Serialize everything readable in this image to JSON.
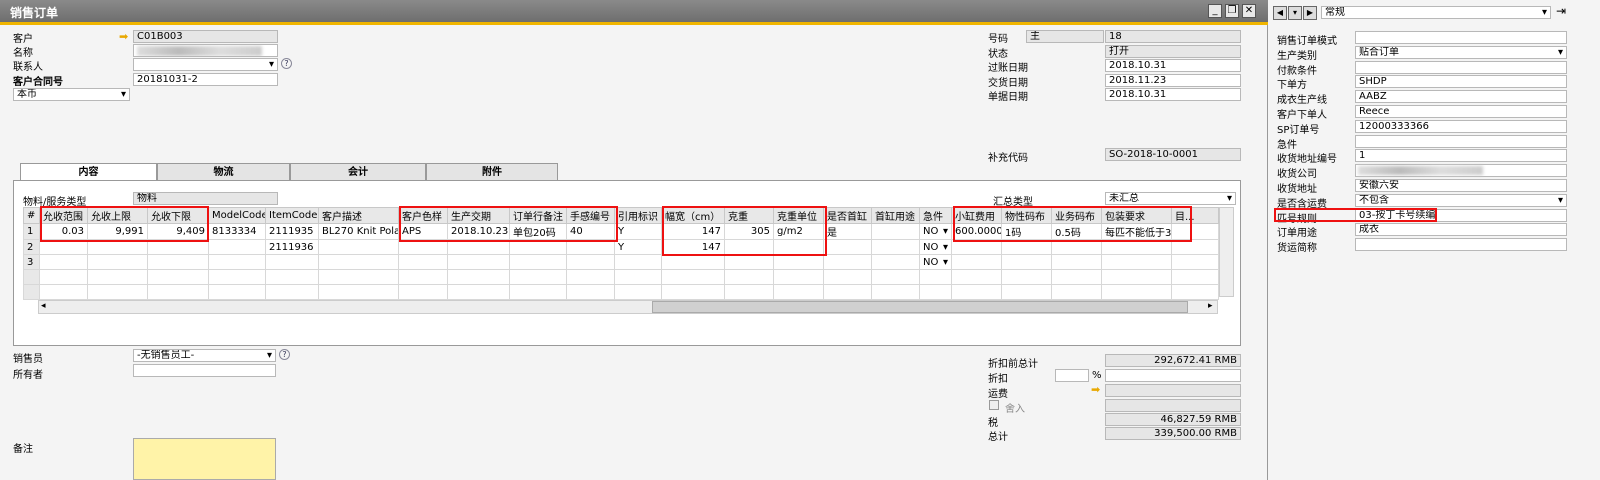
{
  "window": {
    "title": "销售订单"
  },
  "header_left": {
    "customer_label": "客户",
    "customer_value": "C01B003",
    "name_label": "名称",
    "contact_label": "联系人",
    "contract_label": "客户合同号",
    "contract_value": "20181031-2",
    "currency_value": "本币"
  },
  "header_right": {
    "number_label": "号码",
    "series_value": "主",
    "number_value": "18",
    "status_label": "状态",
    "status_value": "打开",
    "posting_label": "过账日期",
    "posting_value": "2018.10.31",
    "delivery_label": "交货日期",
    "delivery_value": "2018.11.23",
    "doc_date_label": "单据日期",
    "doc_date_value": "2018.10.31",
    "supp_code_label": "补充代码",
    "supp_code_value": "SO-2018-10-0001"
  },
  "tabs": [
    "内容",
    "物流",
    "会计",
    "附件"
  ],
  "content": {
    "item_type_label": "物料/服务类型",
    "item_type_value": "物料",
    "summary_label": "汇总类型",
    "summary_value": "未汇总"
  },
  "table": {
    "columns": [
      "#",
      "允收范围",
      "允收上限",
      "允收下限",
      "ModelCode",
      "ItemCode",
      "客户描述",
      "客户色样",
      "生产交期",
      "订单行备注",
      "手感编号",
      "引用标识",
      "幅宽（cm）",
      "克重",
      "克重单位",
      "是否首缸",
      "首缸用途",
      "急件",
      "小缸费用",
      "物性码布",
      "业务码布",
      "包装要求",
      "目..."
    ],
    "rows": [
      [
        "1",
        "0.03",
        "9,991",
        "9,409",
        "8133334",
        "2111935",
        "BL270 Knit Polar",
        "APS",
        "2018.10.23",
        "单包20码",
        "40",
        "Y",
        "147",
        "305",
        "g/m2",
        "是",
        "",
        "NO",
        "600.0000",
        "1码",
        "0.5码",
        "每匹不能低于35码",
        ""
      ],
      [
        "2",
        "",
        "",
        "",
        "",
        "2111936",
        "",
        "",
        "",
        "",
        "",
        "Y",
        "147",
        "",
        "",
        "",
        "",
        "NO",
        "",
        "",
        "",
        "",
        ""
      ],
      [
        "3",
        "",
        "",
        "",
        "",
        "",
        "",
        "",
        "",
        "",
        "",
        "",
        "",
        "",
        "",
        "",
        "",
        "NO",
        "",
        "",
        "",
        "",
        ""
      ]
    ]
  },
  "footer_left": {
    "sales_emp_label": "销售员",
    "sales_emp_value": "-无销售员工-",
    "owner_label": "所有者",
    "remarks_label": "备注"
  },
  "totals": {
    "before_discount_label": "折扣前总计",
    "before_discount_value": "292,672.41 RMB",
    "discount_label": "折扣",
    "discount_unit": "%",
    "freight_label": "运费",
    "rounding_label": "舍入",
    "tax_label": "税",
    "tax_value": "46,827.59 RMB",
    "total_label": "总计",
    "total_value": "339,500.00 RMB"
  },
  "sidebar": {
    "mode_value": "常规",
    "fields": [
      {
        "label": "销售订单模式",
        "value": ""
      },
      {
        "label": "生产类别",
        "value": "贴合订单",
        "dropdown": true
      },
      {
        "label": "付款条件",
        "value": ""
      },
      {
        "label": "下单方",
        "value": "SHDP"
      },
      {
        "label": "成衣生产线",
        "value": "AABZ"
      },
      {
        "label": "客户下单人",
        "value": "Reece"
      },
      {
        "label": "SP订单号",
        "value": "12000333366"
      },
      {
        "label": "急件",
        "value": ""
      },
      {
        "label": "收货地址编号",
        "value": "1"
      },
      {
        "label": "收货公司",
        "value": ""
      },
      {
        "label": "收货地址",
        "value": "安徽六安"
      },
      {
        "label": "是否含运费",
        "value": "不包含",
        "dropdown": true
      },
      {
        "label": "匹号规则",
        "value": "03-按丁卡号续编"
      },
      {
        "label": "订单用途",
        "value": "成衣"
      },
      {
        "label": "货运简称",
        "value": ""
      }
    ]
  }
}
